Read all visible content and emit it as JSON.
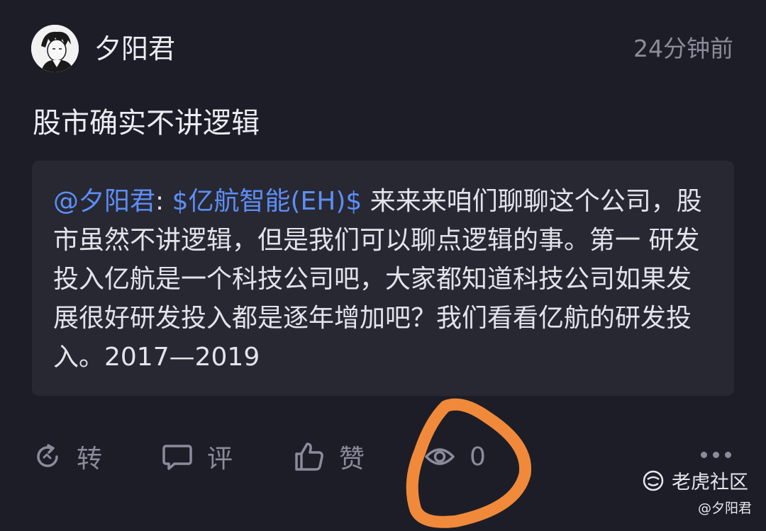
{
  "post": {
    "author": "夕阳君",
    "time": "24分钟前",
    "text": "股市确实不讲逻辑"
  },
  "quote": {
    "mention": "@夕阳君",
    "colon": ":",
    "stock": "$亿航智能(EH)$",
    "body": " 来来来咱们聊聊这个公司，股市虽然不讲逻辑，但是我们可以聊点逻辑的事。第一 研发投入亿航是一个科技公司吧，大家都知道科技公司如果发展很好研发投入都是逐年增加吧？我们看看亿航的研发投入。2017—2019"
  },
  "actions": {
    "repost": "转",
    "comment": "评",
    "like": "赞",
    "views": "0"
  },
  "watermark": {
    "brand": "老虎社区",
    "user": "@夕阳君"
  },
  "colors": {
    "background": "#1d1d27",
    "quote_bg": "#282833",
    "link": "#5d8ef6",
    "highlight": "#f08a3a"
  }
}
